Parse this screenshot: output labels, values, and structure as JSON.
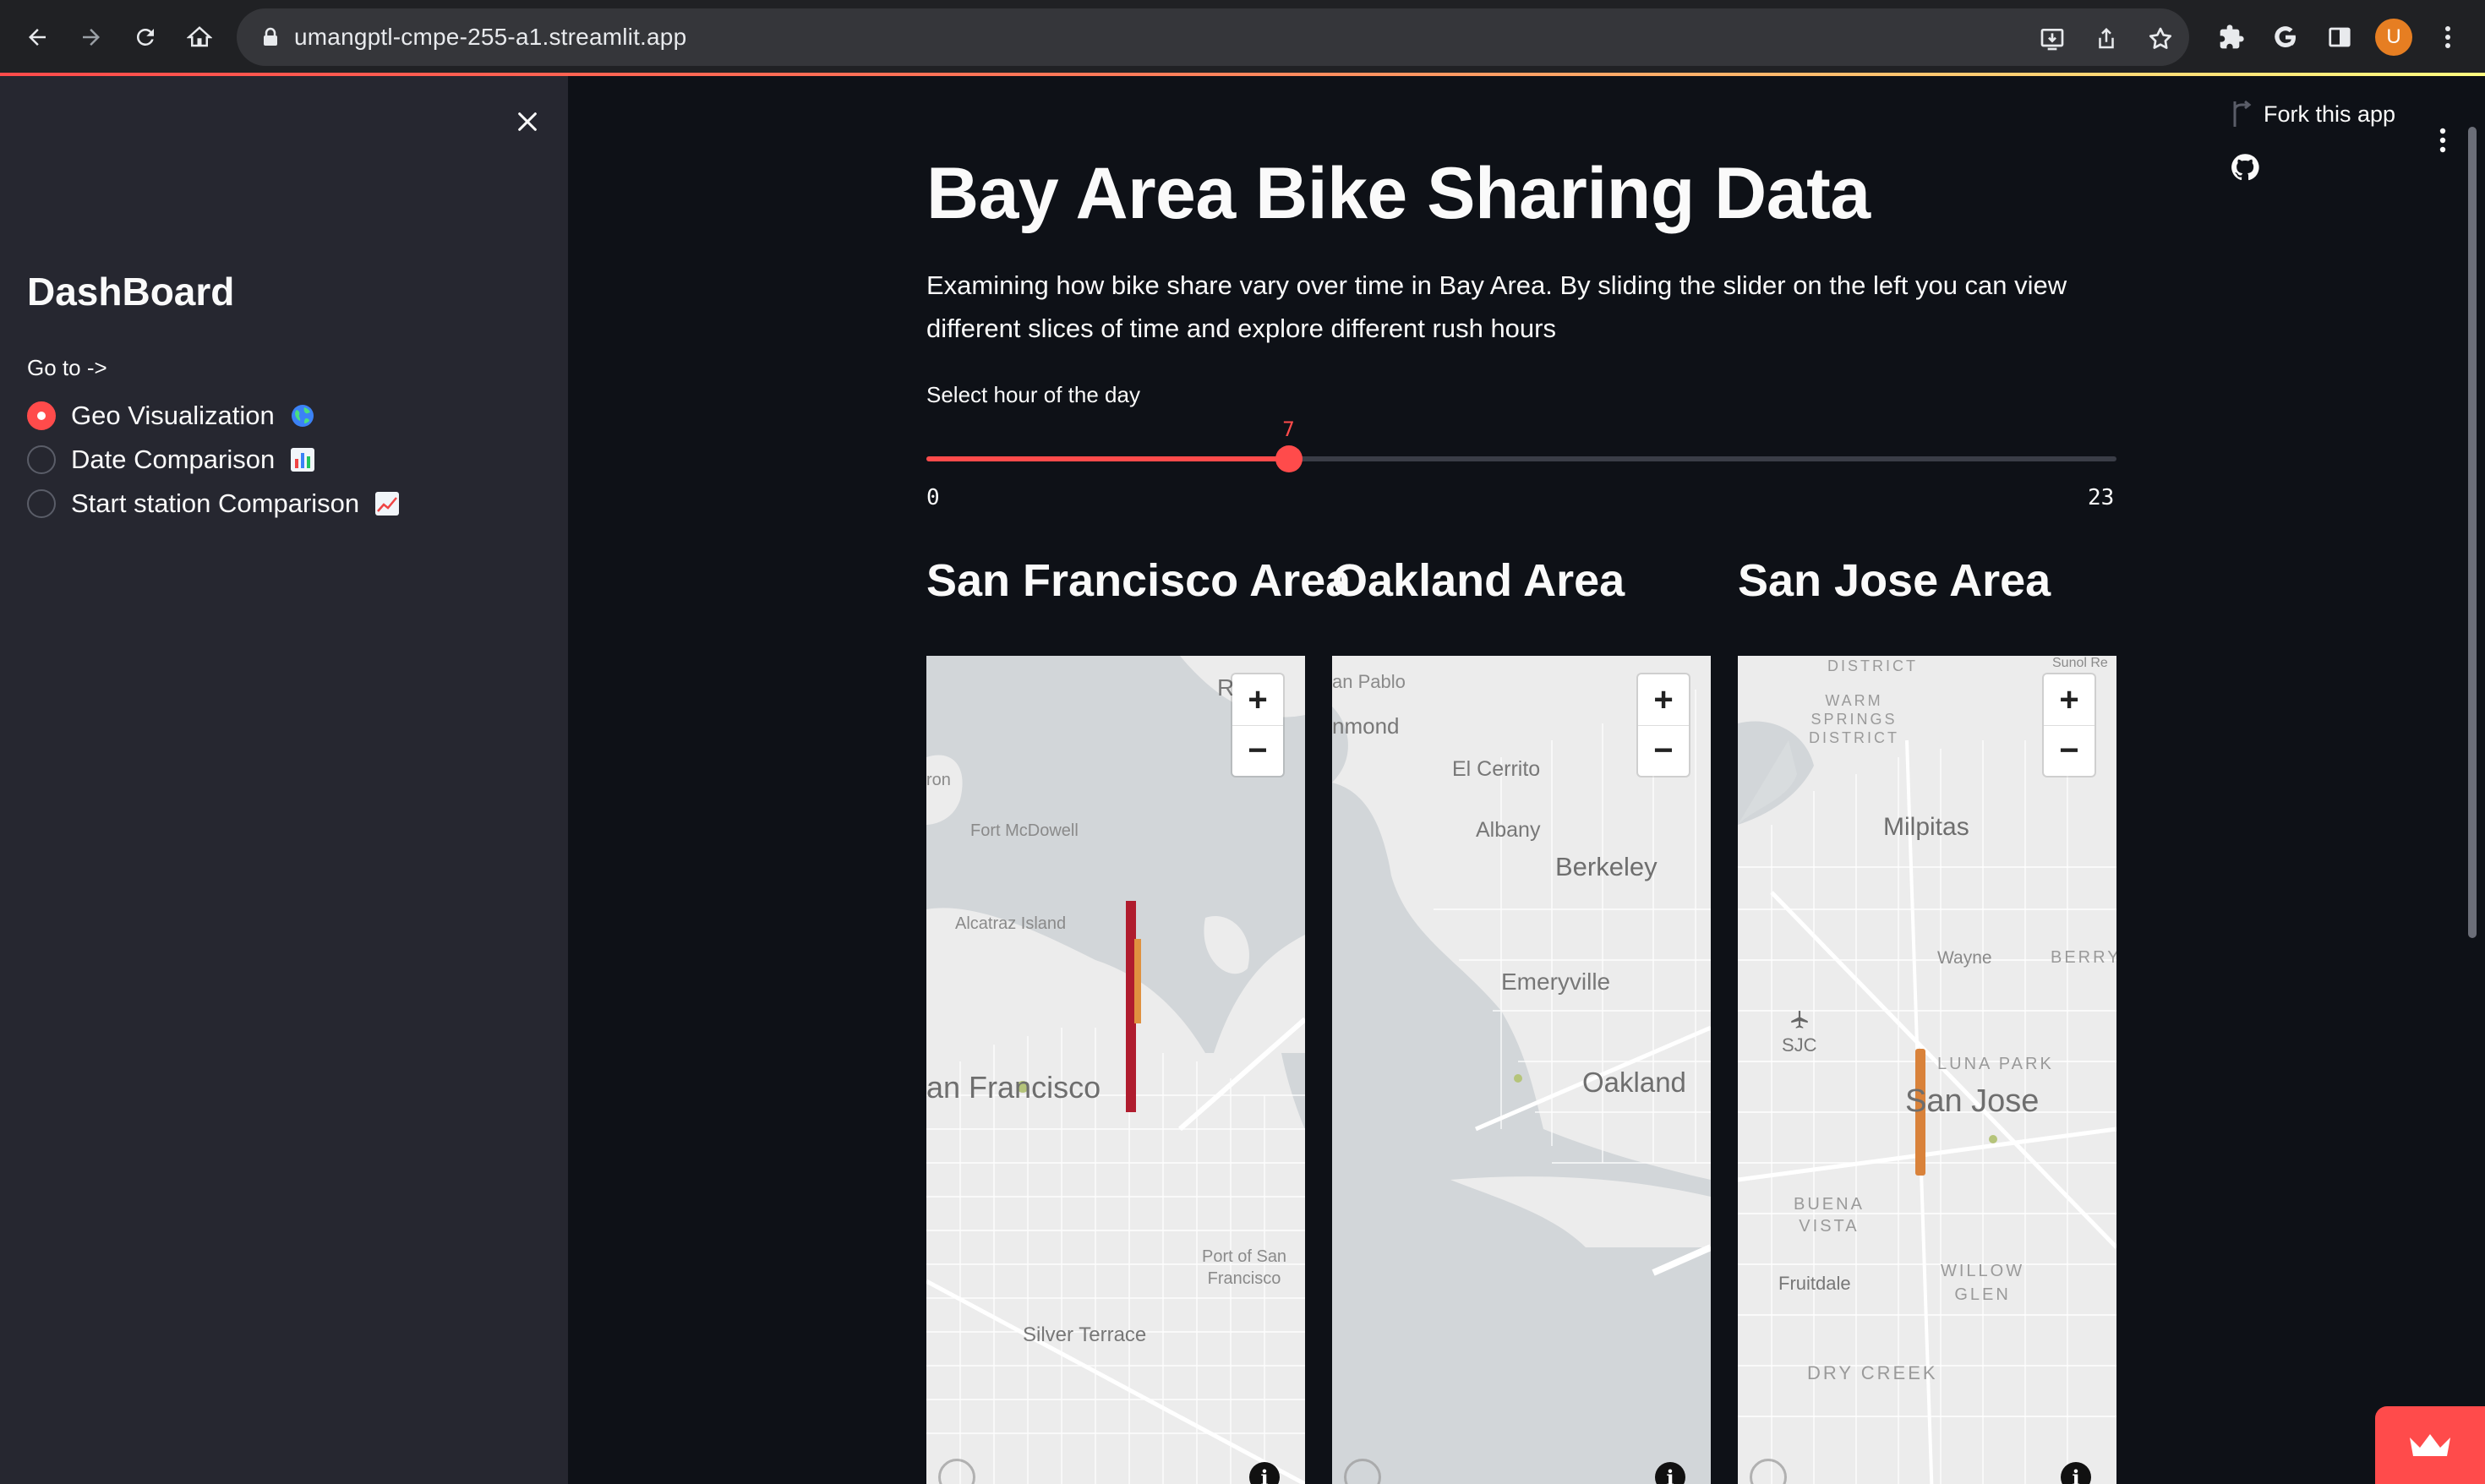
{
  "browser": {
    "url": "umangptl-cmpe-255-a1.streamlit.app",
    "profile_initial": "U"
  },
  "sidebar": {
    "title": "DashBoard",
    "goto_label": "Go to ->",
    "options": [
      {
        "label": "Geo Visualization",
        "emoji_icon": "globe-icon",
        "selected": true
      },
      {
        "label": "Date Comparison",
        "emoji_icon": "bar-chart-icon",
        "selected": false
      },
      {
        "label": "Start station Comparison",
        "emoji_icon": "trend-chart-icon",
        "selected": false
      }
    ]
  },
  "toolbar": {
    "fork_label": "Fork this app"
  },
  "main": {
    "title": "Bay Area Bike Sharing Data",
    "description": "Examining how bike share vary over time in Bay Area. By sliding the slider on the left you can view different slices of time and explore different rush hours",
    "slider": {
      "label": "Select hour of the day",
      "min": 0,
      "max": 23,
      "value": 7,
      "min_label": "0",
      "max_label": "23",
      "value_label": "7",
      "accent_color": "#ff4b4b"
    },
    "areas": [
      {
        "title": "San Francisco Area",
        "labels": [
          "Richmond",
          "Fort McDowell",
          "Alcatraz Island",
          "San Francisco",
          "Port of San Francisco",
          "Silver Terrace",
          "ron"
        ]
      },
      {
        "title": "Oakland Area",
        "labels": [
          "San Pablo",
          "Richmond",
          "El Cerrito",
          "Albany",
          "Berkeley",
          "Emeryville",
          "Oakland"
        ]
      },
      {
        "title": "San Jose Area",
        "labels": [
          "DISTRICT",
          "WARM SPRINGS DISTRICT",
          "Milpitas",
          "Wayne",
          "BERRYESSA",
          "SJC",
          "LUNA PARK",
          "San Jose",
          "BUENA VISTA",
          "Fruitdale",
          "WILLOW GLEN",
          "DRY CREEK",
          "Sunol Regional"
        ]
      }
    ],
    "map_controls": {
      "zoom_in": "+",
      "zoom_out": "−",
      "info": "i"
    }
  }
}
